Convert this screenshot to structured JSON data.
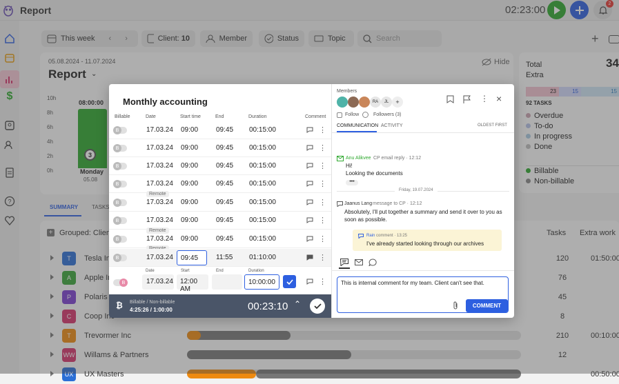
{
  "app": {
    "title": "Report",
    "timer": "02:23:00",
    "notif_count": "2"
  },
  "filters": {
    "period": "This week",
    "client": "Client:",
    "client_count": "10",
    "member": "Member",
    "status": "Status",
    "topic": "Topic",
    "search_placeholder": "Search"
  },
  "report_card": {
    "date_range": "05.08.2024 - 11.07.2024",
    "title": "Report",
    "hide": "Hide",
    "y_ticks": [
      "10h",
      "8h",
      "6h",
      "4h",
      "2h",
      "0h"
    ],
    "bar_label": "08:00:00",
    "bar_badge": "3",
    "day": "Monday",
    "date": "05.08"
  },
  "tabs": {
    "summary": "SUMMARY",
    "tasks": "TASKS"
  },
  "totals": {
    "total": "Total",
    "total_value": "34",
    "extra": "Extra",
    "seg1": "23",
    "seg2": "15",
    "seg3": "15",
    "tasks_label": "92 TASKS",
    "legend": [
      "Overdue",
      "To-do",
      "In progress",
      "Done"
    ],
    "legend_colors": [
      "#c9a3b0",
      "#b3bfe6",
      "#a8c9e0",
      "#bdbdbd"
    ],
    "legend2": [
      "Billable",
      "Non-billable"
    ],
    "legend2_colors": [
      "#2ea82e",
      "#888888"
    ]
  },
  "table": {
    "grouped": "Grouped: Client",
    "col_tasks": "Tasks",
    "col_extra": "Extra work",
    "rows": [
      {
        "logo": "T",
        "color": "#2b6fd6",
        "name": "Tesla Inc",
        "tasks": "120",
        "extra": "01:50:00"
      },
      {
        "logo": "A",
        "color": "#3aa63a",
        "name": "Apple Inc",
        "tasks": "76",
        "extra": ""
      },
      {
        "logo": "P",
        "color": "#7a3fd0",
        "name": "Polaris Inc",
        "tasks": "45",
        "extra": ""
      },
      {
        "logo": "C",
        "color": "#d6336c",
        "name": "Coop Inc",
        "tasks": "8",
        "extra": ""
      },
      {
        "logo": "T",
        "color": "#ee8a10",
        "name": "Trevormer Inc",
        "tasks": "210",
        "extra": "00:10:00"
      },
      {
        "logo": "WW",
        "color": "#d6336c",
        "name": "Willams & Partners",
        "tasks": "12",
        "extra": ""
      },
      {
        "logo": "UX",
        "color": "#2b6fd6",
        "name": "UX Masters",
        "tasks": "",
        "extra": "00:50:00"
      }
    ]
  },
  "modal": {
    "title": "Monthly accounting",
    "headers": [
      "Billable",
      "Date",
      "Start time",
      "End",
      "Duration",
      "Comment"
    ],
    "rows": [
      {
        "date": "17.03.24",
        "start": "09:00",
        "end": "09:45",
        "dur": "00:15:00",
        "remote": ""
      },
      {
        "date": "17.03.24",
        "start": "09:00",
        "end": "09:45",
        "dur": "00:15:00",
        "remote": ""
      },
      {
        "date": "17.03.24",
        "start": "09:00",
        "end": "09:45",
        "dur": "00:15:00",
        "remote": ""
      },
      {
        "date": "17.03.24",
        "start": "09:00",
        "end": "09:45",
        "dur": "00:15:00",
        "remote": ""
      },
      {
        "date": "17.03.24",
        "start": "09:00",
        "end": "09:45",
        "dur": "00:15:00",
        "remote": "Remote"
      },
      {
        "date": "17.03.24",
        "start": "09:00",
        "end": "09:45",
        "dur": "00:15:00",
        "remote": ""
      },
      {
        "date": "17.03.24",
        "start": "09:00",
        "end": "09:45",
        "dur": "00:15:00",
        "remote": "Remote"
      },
      {
        "date": "17.03.24",
        "start": "09:45",
        "end": "11:55",
        "dur": "01:10:00",
        "remote": "Remote"
      }
    ],
    "new_entry": {
      "date_label": "Date",
      "start_label": "Start",
      "end_label": "End",
      "dur_label": "Duration",
      "date": "17.03.24",
      "start": "12:00 AM",
      "end": "",
      "dur": "10:00:00"
    },
    "footer": {
      "label": "Billable / Non-billable",
      "sub": "4:25:26 / 1:00:00",
      "timer": "00:23:10"
    },
    "members_label": "Members",
    "member_initials": [
      "RA",
      "JL"
    ],
    "follow": "Follow",
    "followers": "Followers (3)",
    "tab_comm": "COMMUNICATION",
    "tab_activity": "ACTIVITY",
    "sort": "OLDEST FIRST",
    "msg1": {
      "author": "Anu Alikvee",
      "meta": "CP email reply · 12:12",
      "lines": [
        "Hi!",
        "Looking the documents"
      ]
    },
    "date_sep": "Friday, 19.07.2024",
    "msg2": {
      "author": "Jaanus Lang",
      "meta": "message to CP · 12:12",
      "text": "Absolutely, I'll put together a summary and send it over to you as soon as possible."
    },
    "msg3": {
      "author": "Rain",
      "meta": "comment · 13:25",
      "text": "I've already started looking through our archives"
    },
    "composer": {
      "text": "This is internal comment for my team. Client can't see that.",
      "button": "COMMENT"
    }
  }
}
